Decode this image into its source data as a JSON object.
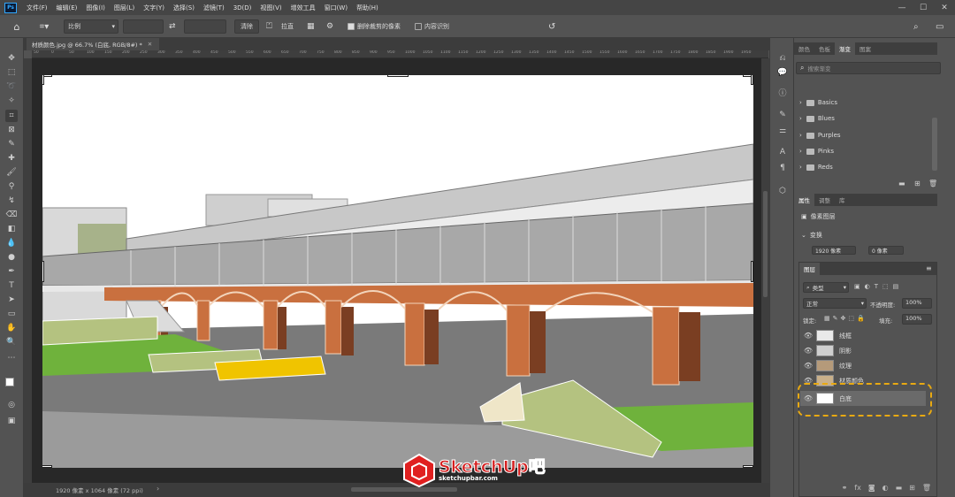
{
  "app": {
    "logo": "Ps"
  },
  "menu": [
    "文件(F)",
    "编辑(E)",
    "图像(I)",
    "图层(L)",
    "文字(Y)",
    "选择(S)",
    "滤镜(T)",
    "3D(D)",
    "视图(V)",
    "增效工具",
    "窗口(W)",
    "帮助(H)"
  ],
  "window_controls": {
    "minimize": "—",
    "maximize": "☐",
    "close": "✕"
  },
  "options_bar": {
    "ratio_label": "比例",
    "clear_button": "清除",
    "straighten_label": "拉直",
    "delete_cropped_label": "删除裁剪的像素",
    "content_aware_label": "内容识别"
  },
  "document": {
    "tab_title": "材质颜色.jpg @ 66.7% (白底, RGB/8#) *",
    "status": "1920 像素 x 1064 像素 (72 ppi)"
  },
  "ruler_ticks": [
    "50",
    "0",
    "50",
    "100",
    "150",
    "200",
    "250",
    "300",
    "350",
    "400",
    "450",
    "500",
    "550",
    "600",
    "650",
    "700",
    "750",
    "800",
    "850",
    "900",
    "950",
    "1000",
    "1050",
    "1100",
    "1150",
    "1200",
    "1250",
    "1300",
    "1350",
    "1400",
    "1450",
    "1500",
    "1550",
    "1600",
    "1650",
    "1700",
    "1750",
    "1800",
    "1850",
    "1900",
    "1950"
  ],
  "swatches_panel": {
    "tabs": [
      "颜色",
      "色板",
      "渐变",
      "图案"
    ],
    "search_placeholder": "搜索渐变",
    "folders": [
      "Basics",
      "Blues",
      "Purples",
      "Pinks",
      "Reds"
    ]
  },
  "properties_panel": {
    "tabs": [
      "属性",
      "调整",
      "库"
    ],
    "pixel_layer_label": "像素图层",
    "transform_label": "变换",
    "w_value": "1920 像素",
    "h_value": "0 像素"
  },
  "layers_panel": {
    "title": "图层",
    "filter_kind": "类型",
    "blend_mode": "正常",
    "opacity_label": "不透明度:",
    "opacity_value": "100%",
    "lock_label": "锁定:",
    "fill_label": "填充:",
    "fill_value": "100%",
    "layers": [
      {
        "name": "线框"
      },
      {
        "name": "阴影"
      },
      {
        "name": "纹理"
      },
      {
        "name": "材质颜色"
      },
      {
        "name": "白底"
      }
    ]
  },
  "watermark": {
    "brand": "SketchUp",
    "suffix": "吧",
    "url": "sketchupbar.com"
  },
  "colors": {
    "accent": "#e8a912",
    "brick": "#c9703f",
    "grass": "#6fb23c"
  }
}
